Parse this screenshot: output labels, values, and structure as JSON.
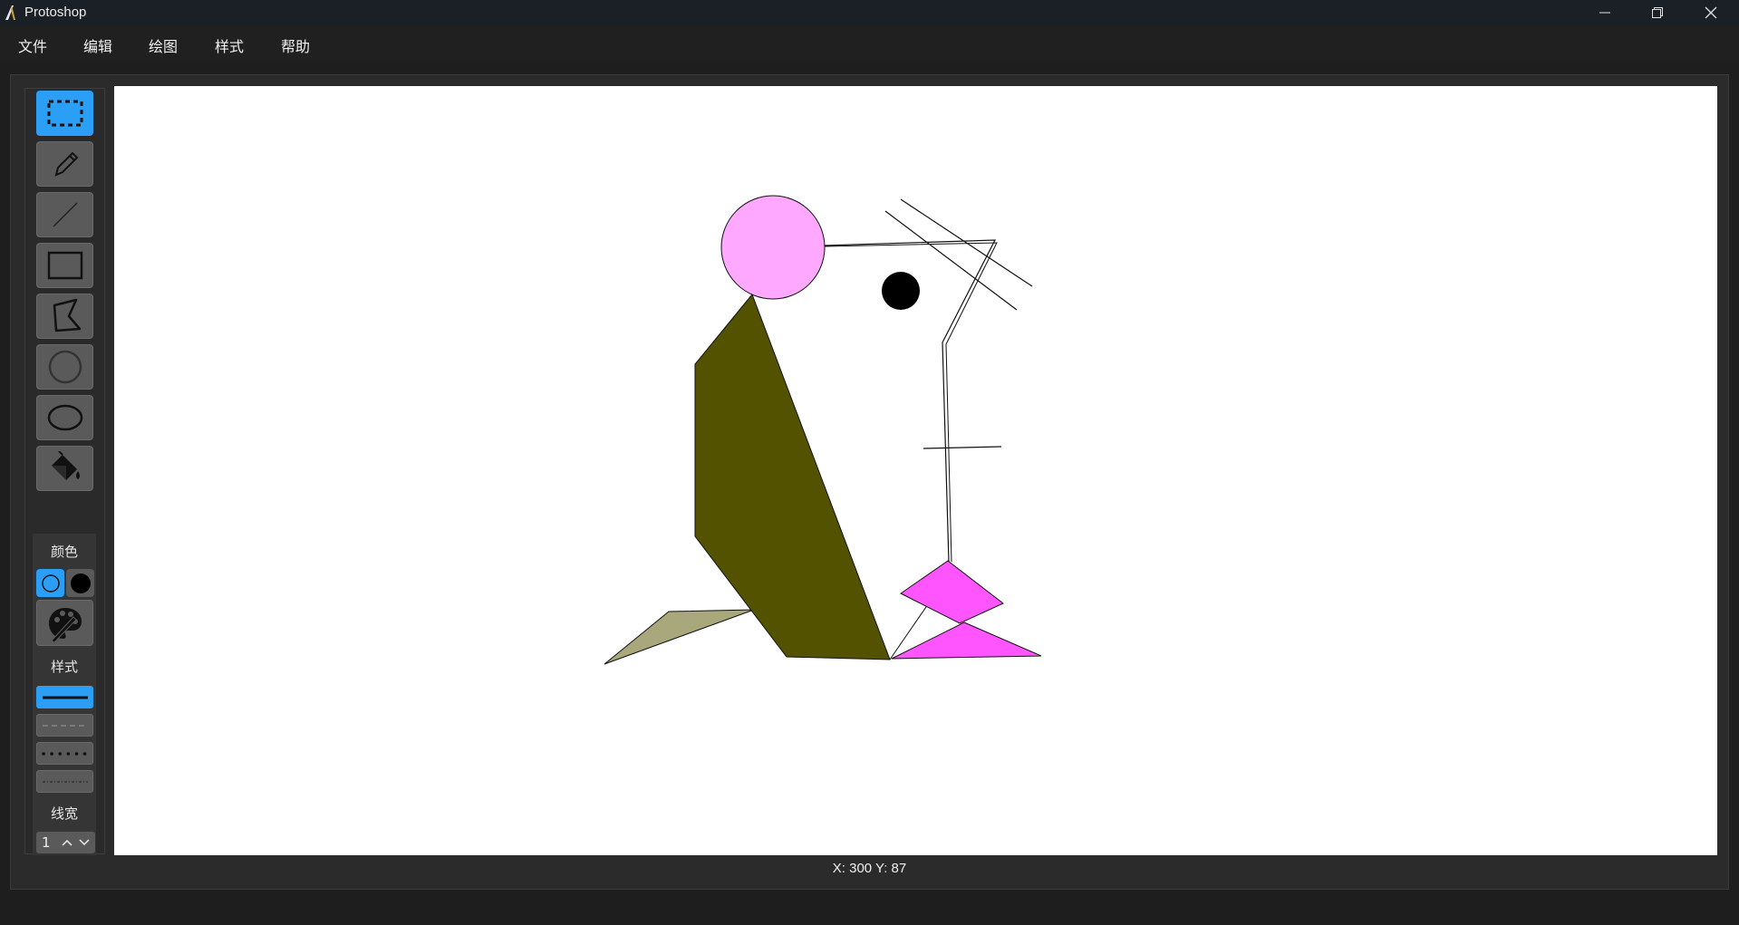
{
  "app": {
    "title": "Protoshop"
  },
  "window_controls": [
    "minimize",
    "restore",
    "close"
  ],
  "menu": {
    "file": "文件",
    "edit": "编辑",
    "draw": "绘图",
    "style": "样式",
    "help": "帮助"
  },
  "tools": [
    {
      "id": "select",
      "icon": "marquee-select-icon",
      "active": true
    },
    {
      "id": "pencil",
      "icon": "pencil-icon",
      "active": false
    },
    {
      "id": "line",
      "icon": "line-icon",
      "active": false
    },
    {
      "id": "rectangle",
      "icon": "rectangle-icon",
      "active": false
    },
    {
      "id": "polygon",
      "icon": "polygon-icon",
      "active": false
    },
    {
      "id": "circle",
      "icon": "circle-icon",
      "active": false
    },
    {
      "id": "ellipse",
      "icon": "ellipse-icon",
      "active": false
    },
    {
      "id": "fill",
      "icon": "paint-bucket-icon",
      "active": false
    }
  ],
  "color_section": {
    "label": "颜色",
    "stroke_color": "#2b9ff5",
    "fill_color": "#000000",
    "palette_icon": "palette-icon"
  },
  "style_section": {
    "label": "样式",
    "options": [
      "solid",
      "dashed",
      "dotted",
      "dash-dot"
    ],
    "selected": "solid"
  },
  "line_width": {
    "label": "线宽",
    "value": "1"
  },
  "drawing": {
    "colors": {
      "circle_fill": "#ffa8ff",
      "body_fill": "#535200",
      "tail_fill": "#a8a87c",
      "triangle_fill": "#ff55ff",
      "eye_fill": "#000000"
    }
  },
  "status": {
    "coords": "X: 300 Y: 87"
  }
}
